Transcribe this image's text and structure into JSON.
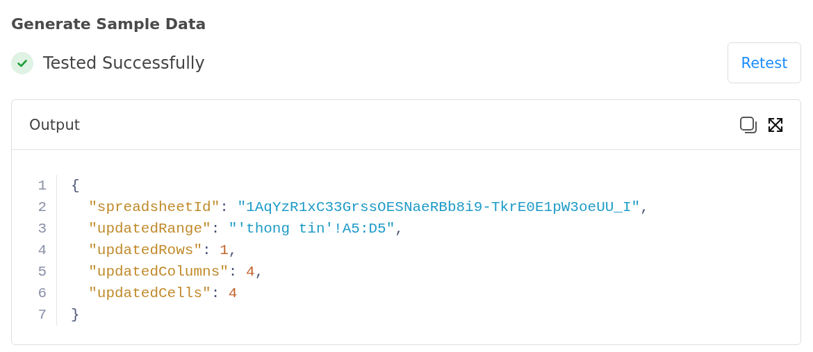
{
  "title": "Generate Sample Data",
  "status": {
    "kind": "success",
    "label": "Tested Successfully"
  },
  "retest_button": "Retest",
  "output": {
    "title": "Output",
    "lines": [
      {
        "number": "1",
        "tokens": [
          {
            "kind": "punct",
            "text": "{"
          }
        ]
      },
      {
        "number": "2",
        "tokens": [
          {
            "kind": "key",
            "text": "  \"spreadsheetId\""
          },
          {
            "kind": "punct",
            "text": ": "
          },
          {
            "kind": "string",
            "text": "\"1AqYzR1xC33GrssOESNaeRBb8i9-TkrE0E1pW3oeUU_I\""
          },
          {
            "kind": "punct",
            "text": ","
          }
        ]
      },
      {
        "number": "3",
        "tokens": [
          {
            "kind": "key",
            "text": "  \"updatedRange\""
          },
          {
            "kind": "punct",
            "text": ": "
          },
          {
            "kind": "string",
            "text": "\"'thong tin'!A5:D5\""
          },
          {
            "kind": "punct",
            "text": ","
          }
        ]
      },
      {
        "number": "4",
        "tokens": [
          {
            "kind": "key",
            "text": "  \"updatedRows\""
          },
          {
            "kind": "punct",
            "text": ": "
          },
          {
            "kind": "number",
            "text": "1"
          },
          {
            "kind": "punct",
            "text": ","
          }
        ]
      },
      {
        "number": "5",
        "tokens": [
          {
            "kind": "key",
            "text": "  \"updatedColumns\""
          },
          {
            "kind": "punct",
            "text": ": "
          },
          {
            "kind": "number",
            "text": "4"
          },
          {
            "kind": "punct",
            "text": ","
          }
        ]
      },
      {
        "number": "6",
        "tokens": [
          {
            "kind": "key",
            "text": "  \"updatedCells\""
          },
          {
            "kind": "punct",
            "text": ": "
          },
          {
            "kind": "number",
            "text": "4"
          }
        ]
      },
      {
        "number": "7",
        "tokens": [
          {
            "kind": "punct",
            "text": "}"
          }
        ]
      }
    ]
  }
}
